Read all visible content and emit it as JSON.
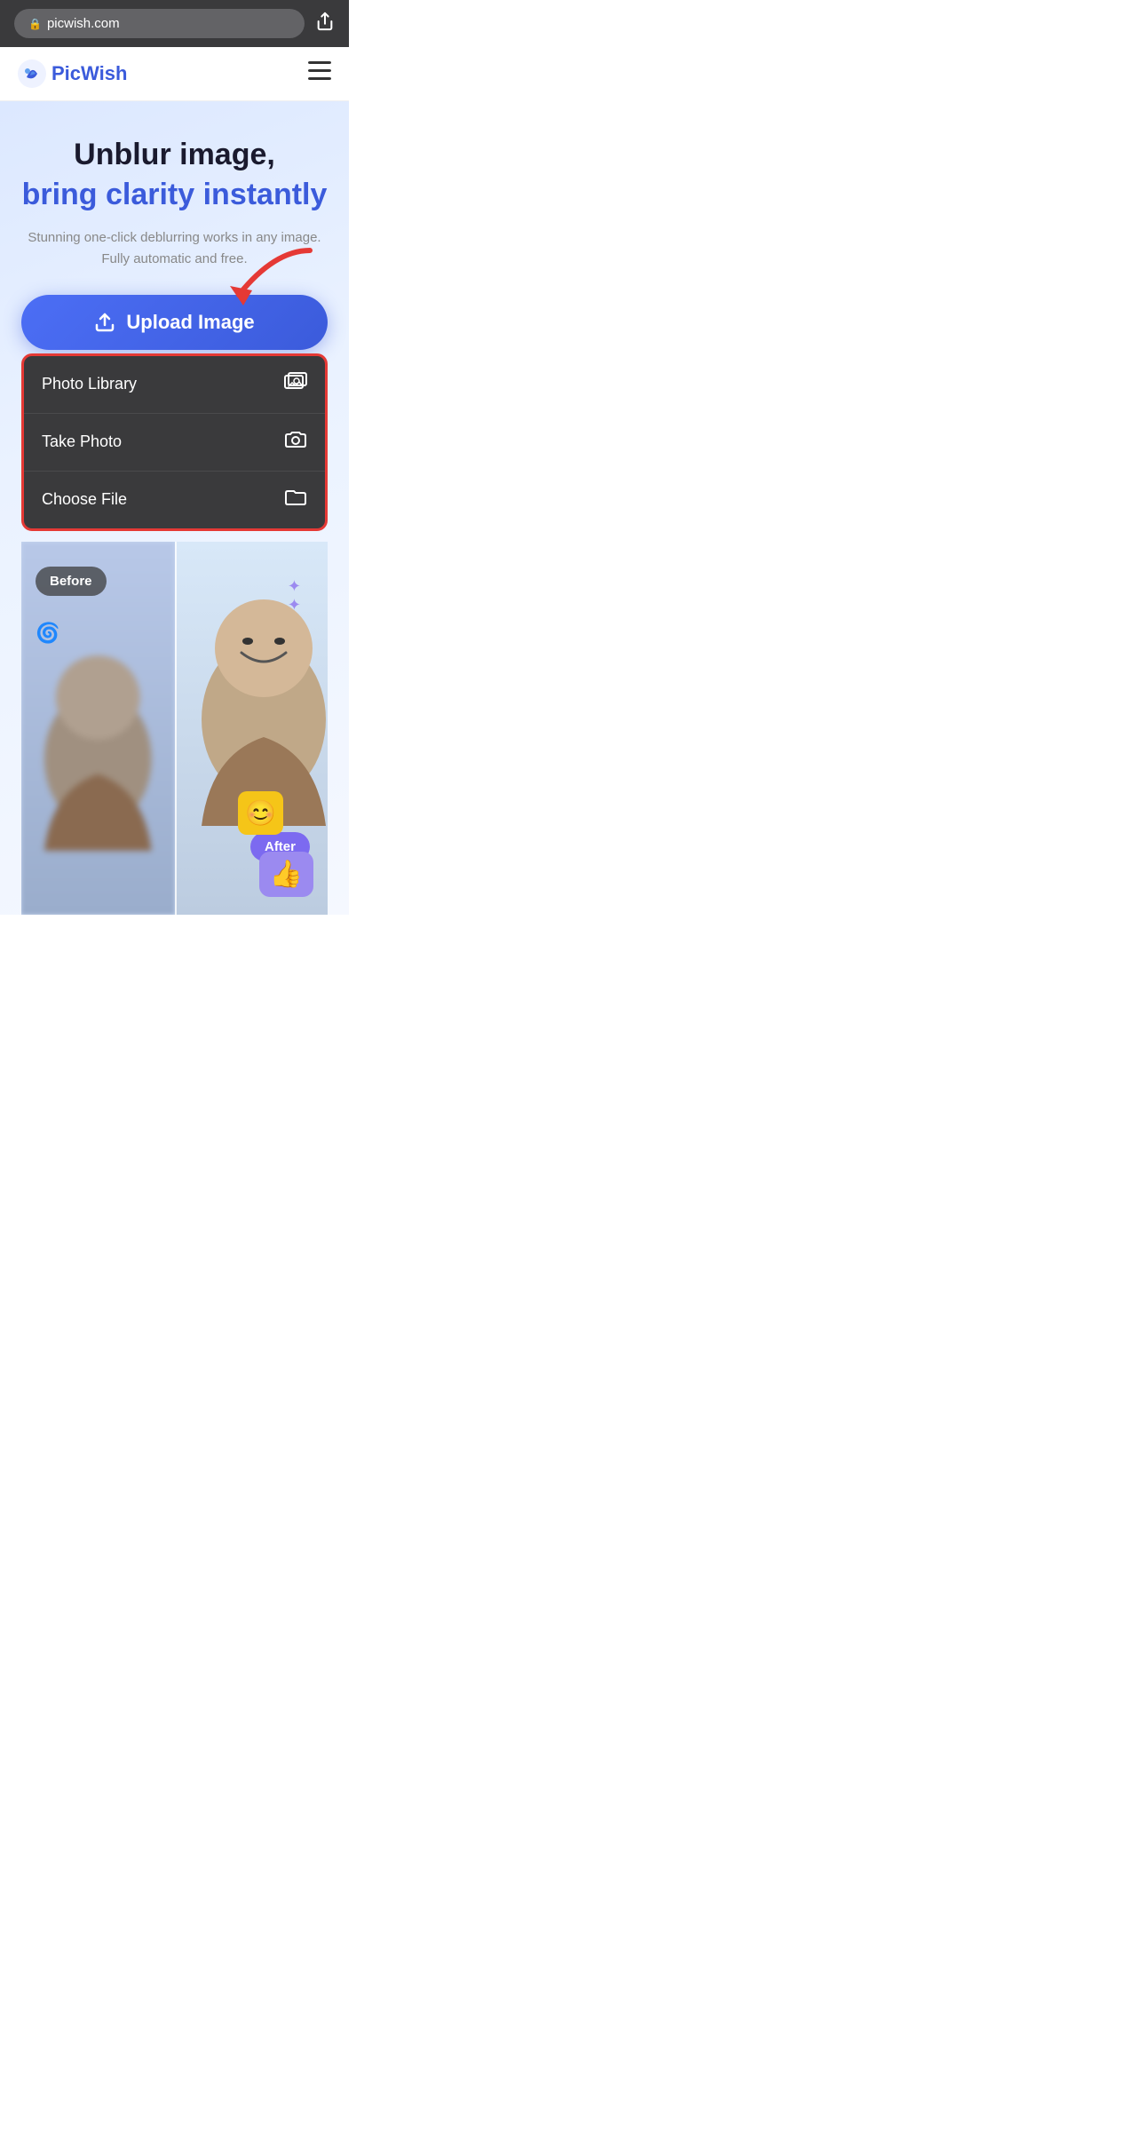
{
  "browser": {
    "url": "picwish.com",
    "lock_icon": "🔒",
    "share_icon": "⬆"
  },
  "nav": {
    "logo_text": "PicWish",
    "hamburger_icon": "≡"
  },
  "hero": {
    "title_black": "Unblur image,",
    "title_blue": "bring clarity instantly",
    "subtitle": "Stunning one-click deblurring works in any image. Fully automatic and free.",
    "upload_button_label": "Upload Image",
    "upload_icon": "⬆"
  },
  "dropdown": {
    "items": [
      {
        "label": "Photo Library",
        "icon": "🖼"
      },
      {
        "label": "Take Photo",
        "icon": "📷"
      },
      {
        "label": "Choose File",
        "icon": "📁"
      }
    ]
  },
  "before_after": {
    "before_label": "Before",
    "after_label": "After"
  }
}
